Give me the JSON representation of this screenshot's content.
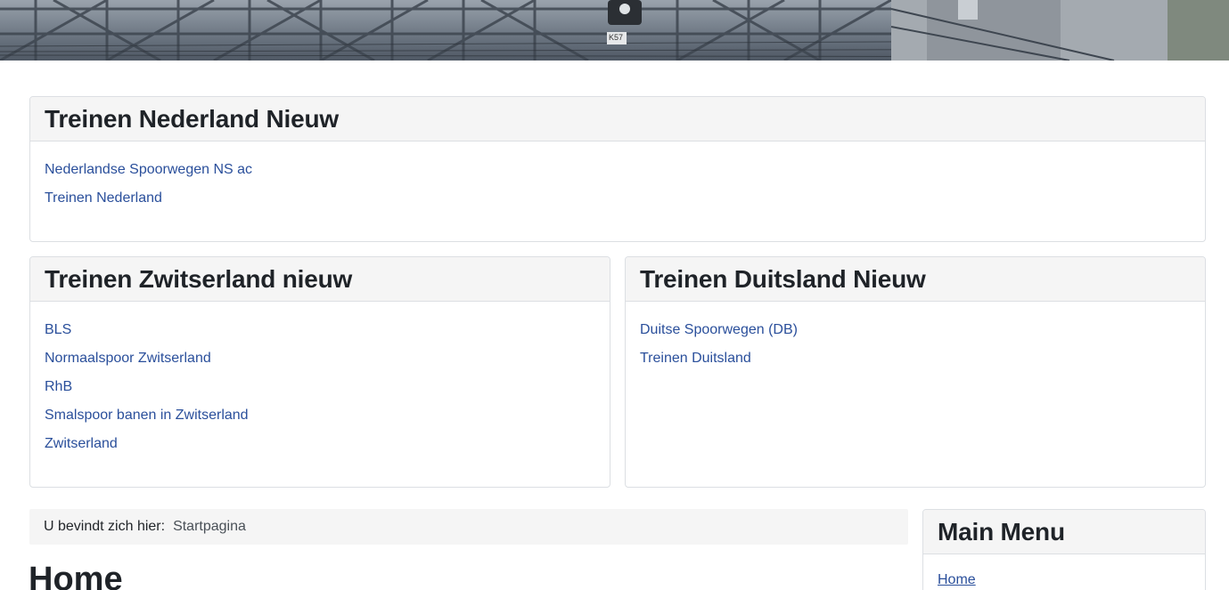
{
  "banner": {
    "alt": "header photo: railway overpass with signal light",
    "sign_text": "K57"
  },
  "sections": {
    "netherlands": {
      "title": "Treinen Nederland Nieuw",
      "links": [
        "Nederlandse Spoorwegen NS ac",
        "Treinen Nederland"
      ]
    },
    "switzerland": {
      "title": "Treinen Zwitserland nieuw",
      "links": [
        "BLS",
        "Normaalspoor Zwitserland",
        "RhB",
        "Smalspoor banen in Zwitserland",
        "Zwitserland"
      ]
    },
    "germany": {
      "title": "Treinen Duitsland Nieuw",
      "links": [
        "Duitse Spoorwegen (DB)",
        "Treinen Duitsland"
      ]
    }
  },
  "breadcrumb": {
    "label": "U bevindt zich hier:",
    "current": "Startpagina"
  },
  "page": {
    "title": "Home"
  },
  "main_menu": {
    "title": "Main Menu",
    "items": [
      "Home"
    ]
  },
  "colors": {
    "link": "#2a4f9b",
    "card_header_bg": "#f5f5f5",
    "border": "#dcdfe3"
  }
}
